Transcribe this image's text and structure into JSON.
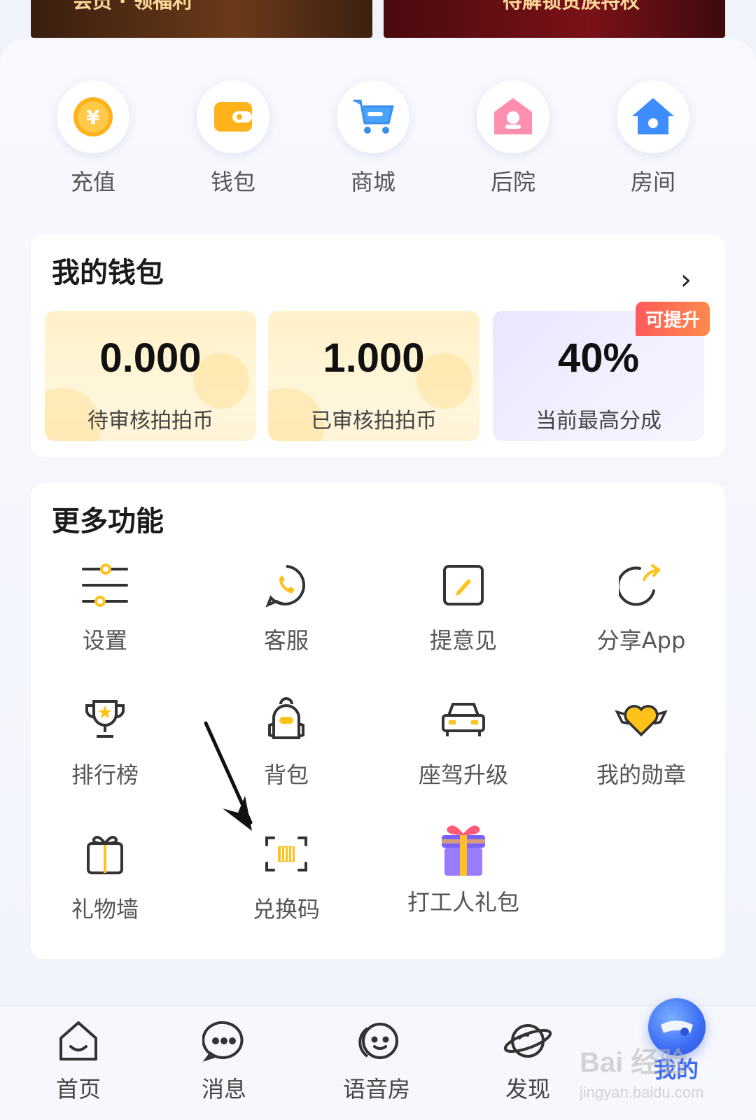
{
  "banners": {
    "left_text": "会员 · 领福利",
    "right_text": "待解锁贵族特权"
  },
  "quick_actions": [
    {
      "label": "充值",
      "icon": "recharge-coin-icon"
    },
    {
      "label": "钱包",
      "icon": "wallet-icon"
    },
    {
      "label": "商城",
      "icon": "shop-cart-icon"
    },
    {
      "label": "后院",
      "icon": "backyard-house-icon"
    },
    {
      "label": "房间",
      "icon": "room-house-icon"
    }
  ],
  "wallet": {
    "title": "我的钱包",
    "arrow": "›",
    "stats": [
      {
        "value": "0.000",
        "label": "待审核拍拍币"
      },
      {
        "value": "1.000",
        "label": "已审核拍拍币"
      },
      {
        "value": "40%",
        "label": "当前最高分成"
      }
    ],
    "badge": "可提升"
  },
  "more": {
    "title": "更多功能",
    "items": [
      {
        "label": "设置",
        "icon": "settings-sliders-icon"
      },
      {
        "label": "客服",
        "icon": "customer-service-phone-icon"
      },
      {
        "label": "提意见",
        "icon": "feedback-edit-icon"
      },
      {
        "label": "分享App",
        "icon": "share-icon"
      },
      {
        "label": "排行榜",
        "icon": "trophy-icon"
      },
      {
        "label": "背包",
        "icon": "backpack-icon"
      },
      {
        "label": "座驾升级",
        "icon": "car-icon"
      },
      {
        "label": "我的勋章",
        "icon": "medal-heart-icon"
      },
      {
        "label": "礼物墙",
        "icon": "gift-wall-icon"
      },
      {
        "label": "兑换码",
        "icon": "redeem-code-scan-icon"
      },
      {
        "label": "打工人礼包",
        "icon": "gift-box-icon"
      }
    ]
  },
  "bottom_nav": [
    {
      "label": "首页",
      "icon": "home-icon"
    },
    {
      "label": "消息",
      "icon": "message-icon"
    },
    {
      "label": "语音房",
      "icon": "voice-room-icon"
    },
    {
      "label": "发现",
      "icon": "discover-planet-icon"
    },
    {
      "label": "我的",
      "icon": "profile-icon"
    }
  ],
  "watermark": {
    "main": "Bai 经验",
    "sub": "jingyan.baidu.com"
  },
  "colors": {
    "accent": "#3b6cf5",
    "gold": "#ffc21a",
    "badge": "#ff5a5a"
  }
}
